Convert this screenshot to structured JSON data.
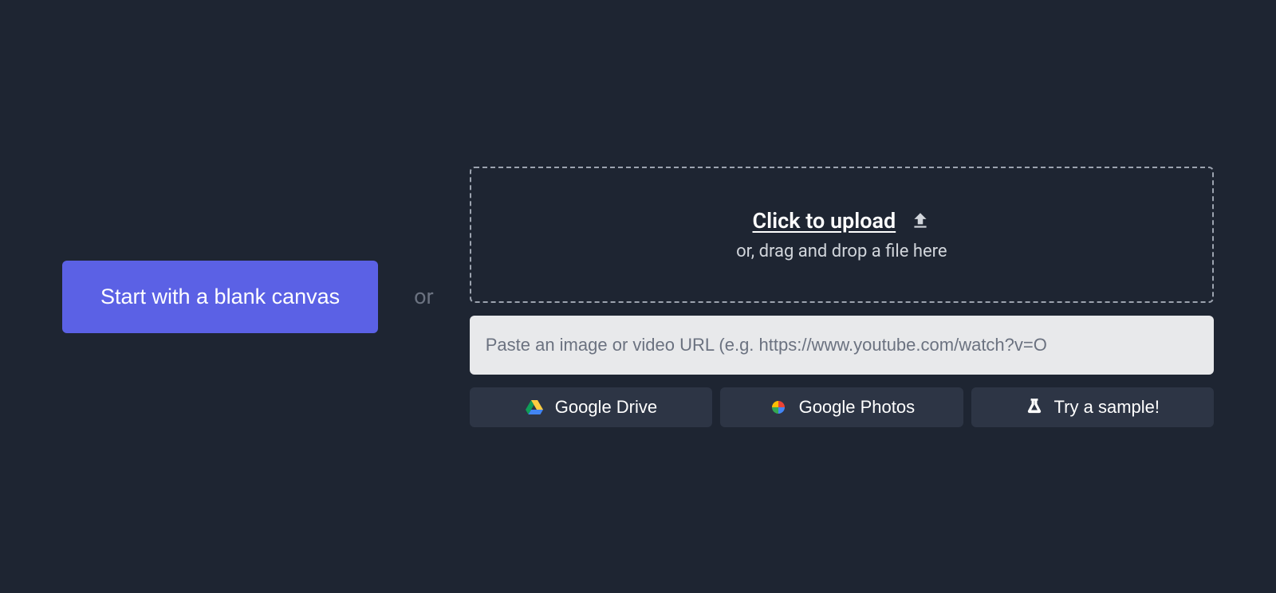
{
  "blank_canvas_label": "Start with a blank canvas",
  "or_label": "or",
  "upload": {
    "title": "Click to upload",
    "subtitle": "or, drag and drop a file here"
  },
  "url_input": {
    "placeholder": "Paste an image or video URL (e.g. https://www.youtube.com/watch?v=O"
  },
  "buttons": {
    "google_drive": "Google Drive",
    "google_photos": "Google Photos",
    "try_sample": "Try a sample!"
  }
}
